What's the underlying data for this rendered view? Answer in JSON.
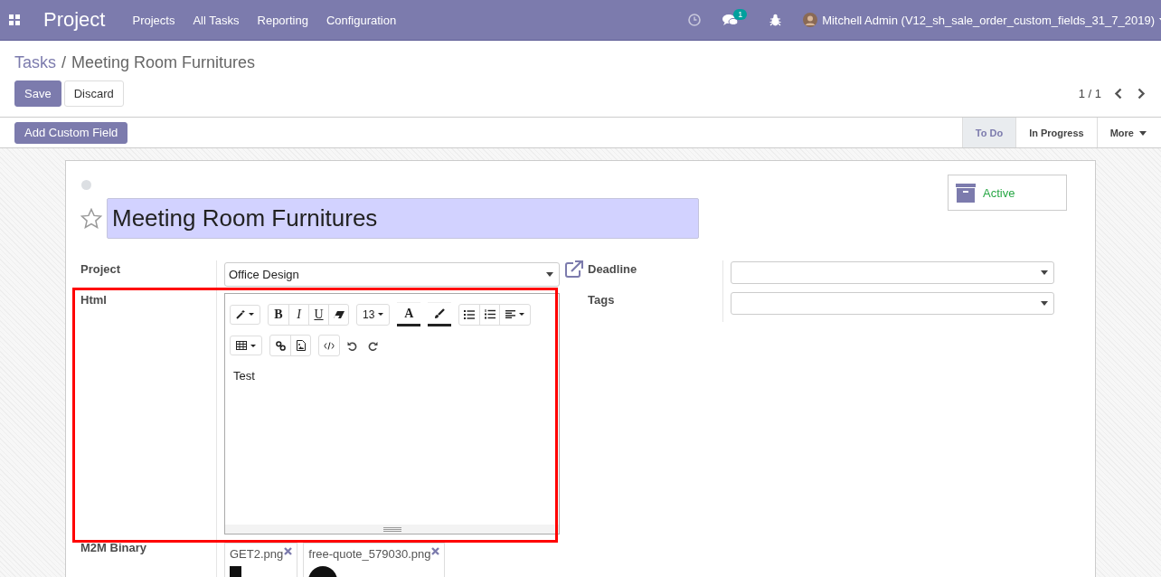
{
  "navbar": {
    "app_name": "Project",
    "menu": [
      {
        "label": "Projects"
      },
      {
        "label": "All Tasks"
      },
      {
        "label": "Reporting"
      },
      {
        "label": "Configuration"
      }
    ],
    "chat_count": "1",
    "user": "Mitchell Admin (V12_sh_sale_order_custom_fields_31_7_2019)"
  },
  "breadcrumb": {
    "parent": "Tasks",
    "separator": "/",
    "current": "Meeting Room Furnitures"
  },
  "buttons": {
    "save": "Save",
    "discard": "Discard"
  },
  "pager": "1 / 1",
  "statusbar": {
    "action": "Add Custom Field",
    "stages": [
      {
        "label": "To Do",
        "selected": true
      },
      {
        "label": "In Progress",
        "selected": false
      }
    ],
    "more": "More"
  },
  "sheet": {
    "starred": false,
    "title": "Meeting Room Furnitures",
    "archive_button": "Active",
    "fields_left": [
      {
        "label": "Project",
        "kind": "select",
        "value": "Office Design"
      },
      {
        "label": "Html",
        "kind": "html",
        "content": "Test",
        "font_size": "13",
        "bold": "B",
        "italic": "I",
        "underline": "U",
        "color_letter": "A"
      },
      {
        "label": "M2M Binary",
        "kind": "attachments",
        "files": [
          {
            "name": "GET2.png"
          },
          {
            "name": "free-quote_579030.png"
          }
        ]
      }
    ],
    "fields_right": [
      {
        "label": "Deadline",
        "link": true
      },
      {
        "label": "Tags",
        "link": false
      }
    ]
  }
}
